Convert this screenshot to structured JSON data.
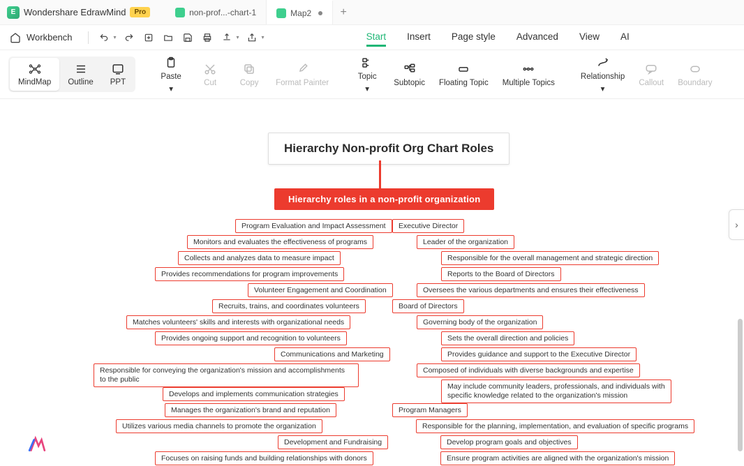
{
  "brand": {
    "name": "Wondershare EdrawMind",
    "badge": "Pro"
  },
  "tabs": [
    {
      "label": "non-prof...-chart-1",
      "active": false
    },
    {
      "label": "Map2",
      "active": true,
      "dirty": true
    }
  ],
  "workbench": "Workbench",
  "menu": {
    "items": [
      "Start",
      "Insert",
      "Page style",
      "Advanced",
      "View",
      "AI"
    ],
    "active": "Start"
  },
  "viewToggle": {
    "options": [
      "MindMap",
      "Outline",
      "PPT"
    ],
    "active": "MindMap"
  },
  "ribbon": {
    "paste": "Paste",
    "cut": "Cut",
    "copy": "Copy",
    "format_painter": "Format Painter",
    "topic": "Topic",
    "subtopic": "Subtopic",
    "floating": "Floating Topic",
    "multiple": "Multiple Topics",
    "relationship": "Relationship",
    "callout": "Callout",
    "boundary": "Boundary"
  },
  "diagram": {
    "title": "Hierarchy Non-profit Org Chart Roles",
    "main": "Hierarchy roles in a non-profit organization",
    "left": {
      "prog_eval": "Program Evaluation and Impact Assessment",
      "monitors": "Monitors and evaluates the effectiveness of programs",
      "collects": "Collects and analyzes data to measure impact",
      "provides_rec": "Provides recommendations for program improvements",
      "volunteer": "Volunteer Engagement and Coordination",
      "recruits": "Recruits, trains, and coordinates volunteers",
      "matches": "Matches volunteers' skills and interests with organizational needs",
      "provides_support": "Provides ongoing support and recognition to volunteers",
      "comms": "Communications and Marketing",
      "responsible_convey": "Responsible for conveying the organization's mission and accomplishments to the public",
      "develops": "Develops and implements communication strategies",
      "manages_brand": "Manages the organization's brand and reputation",
      "utilizes": "Utilizes various media channels to promote the organization",
      "dev_fund": "Development and Fundraising",
      "focuses": "Focuses on raising funds and building relationships with donors"
    },
    "right": {
      "exec_dir": "Executive Director",
      "leader": "Leader of the organization",
      "responsible_overall": "Responsible for the overall management and strategic direction",
      "reports": "Reports to the Board of Directors",
      "oversees": "Oversees the various departments and ensures their effectiveness",
      "board": "Board of Directors",
      "governing": "Governing body of the organization",
      "sets_direction": "Sets the overall direction and policies",
      "provides_guidance": "Provides guidance and support to the Executive Director",
      "composed": "Composed of individuals with diverse backgrounds and expertise",
      "may_include": "May include community leaders, professionals, and individuals with specific knowledge related to the organization's mission",
      "prog_mgr": "Program Managers",
      "responsible_plan": "Responsible for the planning, implementation, and evaluation of specific programs",
      "develop_goals": "Develop program goals and objectives",
      "ensure_align": "Ensure program activities are aligned with the organization's mission"
    }
  }
}
